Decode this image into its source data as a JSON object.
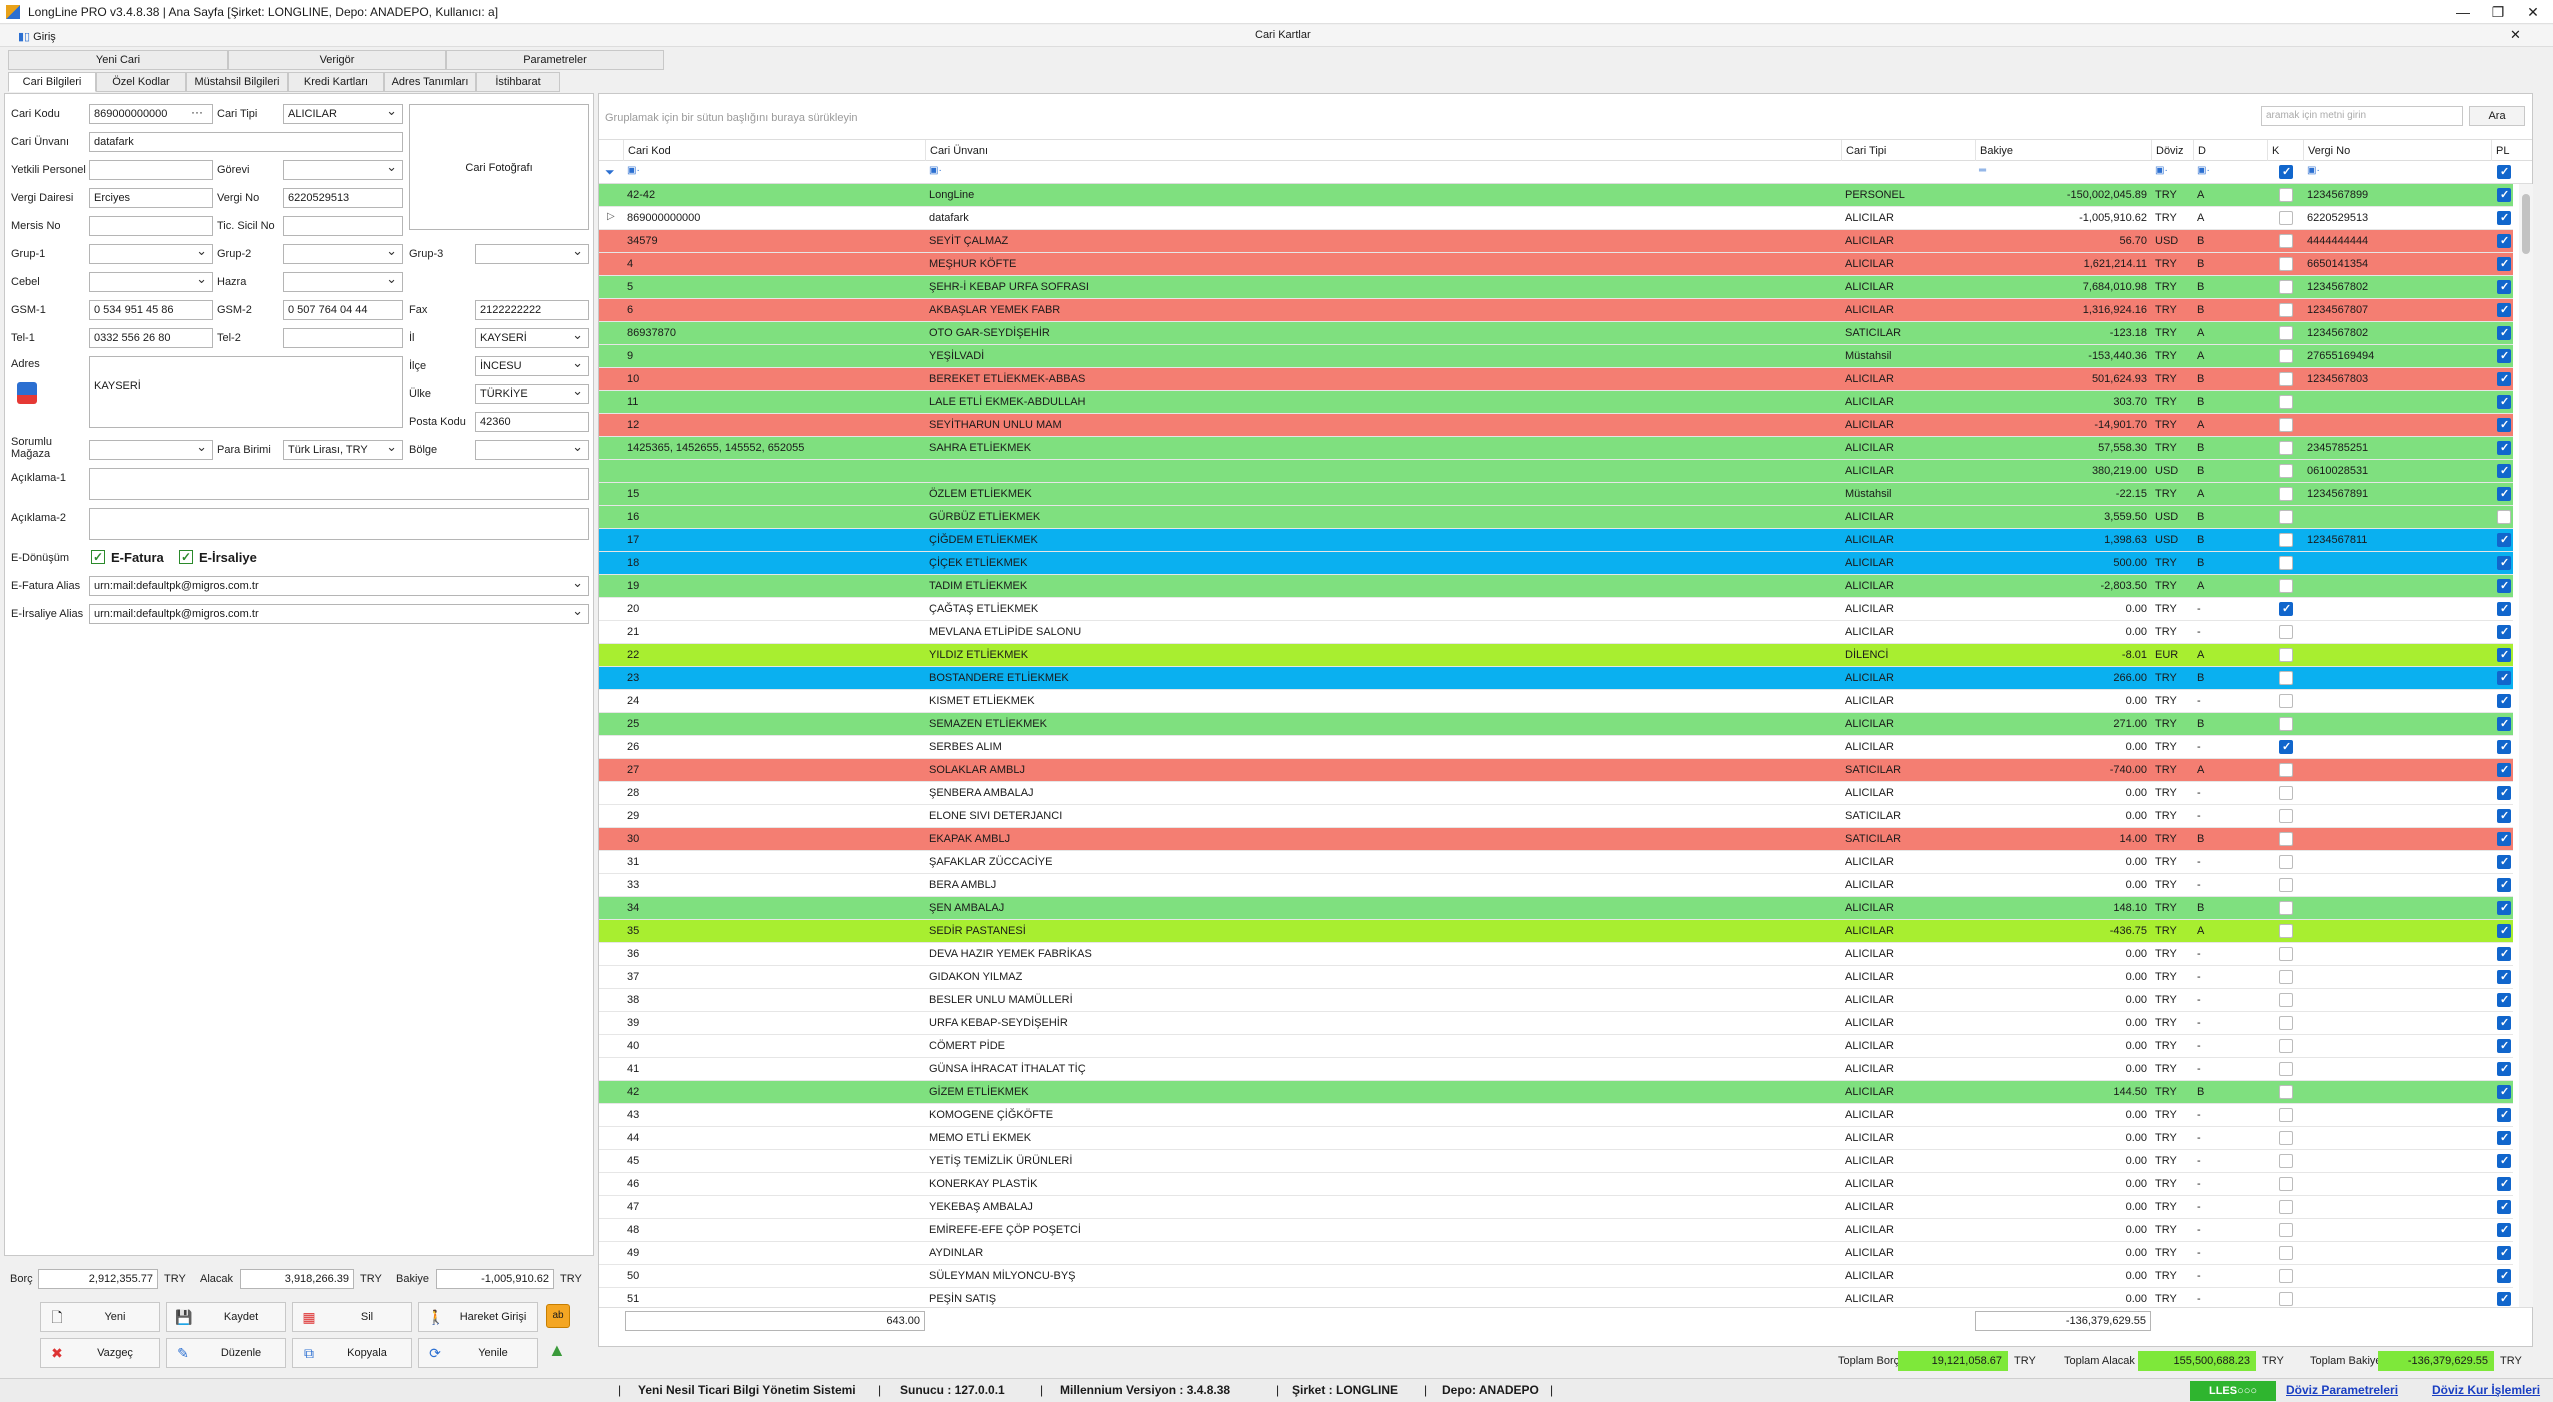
{
  "window": {
    "title": "LongLine PRO v3.4.8.38 | Ana Sayfa [Şirket: LONGLINE, Depo: ANADEPO, Kullanıcı: a]",
    "left_tab": "Giriş",
    "right_tab": "Cari Kartlar"
  },
  "top_tabs": [
    "Yeni Cari",
    "Verigör",
    "Parametreler"
  ],
  "sub_tabs": [
    "Cari Bilgileri",
    "Özel Kodlar",
    "Müstahsil Bilgileri",
    "Kredi Kartları",
    "Adres Tanımları",
    "İstihbarat"
  ],
  "form": {
    "cari_kodu_label": "Cari Kodu",
    "cari_kodu": "869000000000",
    "cari_tipi_label": "Cari Tipi",
    "cari_tipi": "ALICILAR",
    "cari_unvani_label": "Cari Ünvanı",
    "cari_unvani": "datafark",
    "photo_label": "Cari Fotoğrafı",
    "yetkili_label": "Yetkili Personel",
    "yetkili": "",
    "gorevi_label": "Görevi",
    "gorevi": "",
    "vergi_dairesi_label": "Vergi Dairesi",
    "vergi_dairesi": "Erciyes",
    "vergi_no_label": "Vergi No",
    "vergi_no": "6220529513",
    "mersis_label": "Mersis No",
    "mersis": "",
    "sicil_label": "Tic. Sicil No",
    "sicil": "",
    "grup1_label": "Grup-1",
    "grup2_label": "Grup-2",
    "grup3_label": "Grup-3",
    "cebel_label": "Cebel",
    "hazra_label": "Hazra",
    "gsm1_label": "GSM-1",
    "gsm1": "0 534 951 45 86",
    "gsm2_label": "GSM-2",
    "gsm2": "0 507 764 04 44",
    "fax_label": "Fax",
    "fax": "2122222222",
    "tel1_label": "Tel-1",
    "tel1": "0332 556 26 80",
    "tel2_label": "Tel-2",
    "tel2": "",
    "il_label": "İl",
    "il": "KAYSERİ",
    "adres_label": "Adres",
    "adres": "KAYSERİ",
    "ilce_label": "İlçe",
    "ilce": "İNCESU",
    "ulke_label": "Ülke",
    "ulke": "TÜRKİYE",
    "posta_label": "Posta Kodu",
    "posta": "42360",
    "sorumlu_label": "Sorumlu Mağaza",
    "para_label": "Para Birimi",
    "para": "Türk Lirası, TRY",
    "bolge_label": "Bölge",
    "aciklama1_label": "Açıklama-1",
    "aciklama2_label": "Açıklama-2",
    "edonusum_label": "E-Dönüşüm",
    "efatura": "E-Fatura",
    "eirsaliye": "E-İrsaliye",
    "efatura_alias_label": "E-Fatura Alias",
    "efatura_alias": "urn:mail:defaultpk@migros.com.tr",
    "eirsaliye_alias_label": "E-İrsaliye Alias",
    "eirsaliye_alias": "urn:mail:defaultpk@migros.com.tr"
  },
  "totals": {
    "borc_label": "Borç",
    "borc": "2,912,355.77",
    "borc_cur": "TRY",
    "alacak_label": "Alacak",
    "alacak": "3,918,266.39",
    "alacak_cur": "TRY",
    "bakiye_label": "Bakiye",
    "bakiye": "-1,005,910.62",
    "bakiye_cur": "TRY"
  },
  "buttons": {
    "yeni": "Yeni",
    "kaydet": "Kaydet",
    "sil": "Sil",
    "hareket": "Hareket Girişi",
    "vazgec": "Vazgeç",
    "duzenle": "Düzenle",
    "kopyala": "Kopyala",
    "yenile": "Yenile"
  },
  "grid": {
    "group_hint": "Gruplamak için bir sütun başlığını buraya sürükleyin",
    "search_placeholder": "aramak için metni girin",
    "search_button": "Ara",
    "columns": [
      "Cari Kod",
      "Cari Ünvanı",
      "Cari Tipi",
      "Bakiye",
      "Döviz",
      "D",
      "K",
      "Vergi No",
      "PL"
    ],
    "rows": [
      {
        "kod": "42-42",
        "unvan": "LongLine",
        "tip": "PERSONEL",
        "bakiye": "-150,002,045.89",
        "doviz": "TRY",
        "d": "A",
        "k": false,
        "vno": "1234567899",
        "pl": true,
        "bg": "#7fe07f"
      },
      {
        "kod": "869000000000",
        "unvan": "datafark",
        "tip": "ALICILAR",
        "bakiye": "-1,005,910.62",
        "doviz": "TRY",
        "d": "A",
        "k": false,
        "vno": "6220529513",
        "pl": true,
        "bg": "#ffffff",
        "sel": true
      },
      {
        "kod": "34579",
        "unvan": "SEYİT ÇALMAZ",
        "tip": "ALICILAR",
        "bakiye": "56.70",
        "doviz": "USD",
        "d": "B",
        "k": false,
        "vno": "4444444444",
        "pl": true,
        "bg": "#f47e72"
      },
      {
        "kod": "4",
        "unvan": "MEŞHUR KÖFTE",
        "tip": "ALICILAR",
        "bakiye": "1,621,214.11",
        "doviz": "TRY",
        "d": "B",
        "k": false,
        "vno": "6650141354",
        "pl": true,
        "bg": "#f47e72"
      },
      {
        "kod": "5",
        "unvan": "ŞEHR-İ KEBAP URFA SOFRASI",
        "tip": "ALICILAR",
        "bakiye": "7,684,010.98",
        "doviz": "TRY",
        "d": "B",
        "k": false,
        "vno": "1234567802",
        "pl": true,
        "bg": "#7fe07f"
      },
      {
        "kod": "6",
        "unvan": "AKBAŞLAR YEMEK FABR",
        "tip": "ALICILAR",
        "bakiye": "1,316,924.16",
        "doviz": "TRY",
        "d": "B",
        "k": false,
        "vno": "1234567807",
        "pl": true,
        "bg": "#f47e72"
      },
      {
        "kod": "86937870",
        "unvan": "OTO GAR-SEYDİŞEHİR",
        "tip": "SATICILAR",
        "bakiye": "-123.18",
        "doviz": "TRY",
        "d": "A",
        "k": false,
        "vno": "1234567802",
        "pl": true,
        "bg": "#7fe07f"
      },
      {
        "kod": "9",
        "unvan": "YEŞİLVADİ",
        "tip": "Müstahsil",
        "bakiye": "-153,440.36",
        "doviz": "TRY",
        "d": "A",
        "k": false,
        "vno": "27655169494",
        "pl": true,
        "bg": "#7fe07f"
      },
      {
        "kod": "10",
        "unvan": "BEREKET ETLİEKMEK-ABBAS",
        "tip": "ALICILAR",
        "bakiye": "501,624.93",
        "doviz": "TRY",
        "d": "B",
        "k": false,
        "vno": "1234567803",
        "pl": true,
        "bg": "#f47e72"
      },
      {
        "kod": "11",
        "unvan": "LALE ETLİ EKMEK-ABDULLAH",
        "tip": "ALICILAR",
        "bakiye": "303.70",
        "doviz": "TRY",
        "d": "B",
        "k": false,
        "vno": "",
        "pl": true,
        "bg": "#7fe07f"
      },
      {
        "kod": "12",
        "unvan": "SEYİTHARUN UNLU MAM",
        "tip": "ALICILAR",
        "bakiye": "-14,901.70",
        "doviz": "TRY",
        "d": "A",
        "k": false,
        "vno": "",
        "pl": true,
        "bg": "#f47e72"
      },
      {
        "kod": "1425365, 1452655, 145552, 652055",
        "unvan": "SAHRA ETLİEKMEK",
        "tip": "ALICILAR",
        "bakiye": "57,558.30",
        "doviz": "TRY",
        "d": "B",
        "k": false,
        "vno": "2345785251",
        "pl": true,
        "bg": "#7fe07f"
      },
      {
        "kod": "",
        "unvan": "",
        "tip": "ALICILAR",
        "bakiye": "380,219.00",
        "doviz": "USD",
        "d": "B",
        "k": false,
        "vno": "0610028531",
        "pl": true,
        "bg": "#7fe07f"
      },
      {
        "kod": "15",
        "unvan": "ÖZLEM ETLİEKMEK",
        "tip": "Müstahsil",
        "bakiye": "-22.15",
        "doviz": "TRY",
        "d": "A",
        "k": false,
        "vno": "1234567891",
        "pl": true,
        "bg": "#7fe07f"
      },
      {
        "kod": "16",
        "unvan": "GÜRBÜZ ETLİEKMEK",
        "tip": "ALICILAR",
        "bakiye": "3,559.50",
        "doviz": "USD",
        "d": "B",
        "k": false,
        "vno": "",
        "pl": false,
        "bg": "#7fe07f"
      },
      {
        "kod": "17",
        "unvan": "ÇİĞDEM ETLİEKMEK",
        "tip": "ALICILAR",
        "bakiye": "1,398.63",
        "doviz": "USD",
        "d": "B",
        "k": false,
        "vno": "1234567811",
        "pl": true,
        "bg": "#0ab0f0"
      },
      {
        "kod": "18",
        "unvan": "ÇİÇEK ETLİEKMEK",
        "tip": "ALICILAR",
        "bakiye": "500.00",
        "doviz": "TRY",
        "d": "B",
        "k": false,
        "vno": "",
        "pl": true,
        "bg": "#0ab0f0"
      },
      {
        "kod": "19",
        "unvan": "TADIM ETLİEKMEK",
        "tip": "ALICILAR",
        "bakiye": "-2,803.50",
        "doviz": "TRY",
        "d": "A",
        "k": false,
        "vno": "",
        "pl": true,
        "bg": "#7fe07f"
      },
      {
        "kod": "20",
        "unvan": "ÇAĞTAŞ ETLİEKMEK",
        "tip": "ALICILAR",
        "bakiye": "0.00",
        "doviz": "TRY",
        "d": "-",
        "k": true,
        "vno": "",
        "pl": true,
        "bg": "#ffffff"
      },
      {
        "kod": "21",
        "unvan": "MEVLANA ETLİPİDE SALONU",
        "tip": "ALICILAR",
        "bakiye": "0.00",
        "doviz": "TRY",
        "d": "-",
        "k": false,
        "vno": "",
        "pl": true,
        "bg": "#ffffff"
      },
      {
        "kod": "22",
        "unvan": "YILDIZ ETLİEKMEK",
        "tip": "DİLENCİ",
        "bakiye": "-8.01",
        "doviz": "EUR",
        "d": "A",
        "k": false,
        "vno": "",
        "pl": true,
        "bg": "#a8ee30"
      },
      {
        "kod": "23",
        "unvan": "BOSTANDERE ETLİEKMEK",
        "tip": "ALICILAR",
        "bakiye": "266.00",
        "doviz": "TRY",
        "d": "B",
        "k": false,
        "vno": "",
        "pl": true,
        "bg": "#0ab0f0"
      },
      {
        "kod": "24",
        "unvan": "KISMET ETLİEKMEK",
        "tip": "ALICILAR",
        "bakiye": "0.00",
        "doviz": "TRY",
        "d": "-",
        "k": false,
        "vno": "",
        "pl": true,
        "bg": "#ffffff"
      },
      {
        "kod": "25",
        "unvan": "SEMAZEN ETLİEKMEK",
        "tip": "ALICILAR",
        "bakiye": "271.00",
        "doviz": "TRY",
        "d": "B",
        "k": false,
        "vno": "",
        "pl": true,
        "bg": "#7fe07f"
      },
      {
        "kod": "26",
        "unvan": "SERBES ALIM",
        "tip": "ALICILAR",
        "bakiye": "0.00",
        "doviz": "TRY",
        "d": "-",
        "k": true,
        "vno": "",
        "pl": true,
        "bg": "#ffffff"
      },
      {
        "kod": "27",
        "unvan": "SOLAKLAR AMBLJ",
        "tip": "SATICILAR",
        "bakiye": "-740.00",
        "doviz": "TRY",
        "d": "A",
        "k": false,
        "vno": "",
        "pl": true,
        "bg": "#f47e72"
      },
      {
        "kod": "28",
        "unvan": "ŞENBERA AMBALAJ",
        "tip": "ALICILAR",
        "bakiye": "0.00",
        "doviz": "TRY",
        "d": "-",
        "k": false,
        "vno": "",
        "pl": true,
        "bg": "#ffffff"
      },
      {
        "kod": "29",
        "unvan": "ELONE SIVI DETERJANCI",
        "tip": "SATICILAR",
        "bakiye": "0.00",
        "doviz": "TRY",
        "d": "-",
        "k": false,
        "vno": "",
        "pl": true,
        "bg": "#ffffff"
      },
      {
        "kod": "30",
        "unvan": "EKAPAK AMBLJ",
        "tip": "SATICILAR",
        "bakiye": "14.00",
        "doviz": "TRY",
        "d": "B",
        "k": false,
        "vno": "",
        "pl": true,
        "bg": "#f47e72"
      },
      {
        "kod": "31",
        "unvan": "ŞAFAKLAR ZÜCCACİYE",
        "tip": "ALICILAR",
        "bakiye": "0.00",
        "doviz": "TRY",
        "d": "-",
        "k": false,
        "vno": "",
        "pl": true,
        "bg": "#ffffff"
      },
      {
        "kod": "33",
        "unvan": "BERA AMBLJ",
        "tip": "ALICILAR",
        "bakiye": "0.00",
        "doviz": "TRY",
        "d": "-",
        "k": false,
        "vno": "",
        "pl": true,
        "bg": "#ffffff"
      },
      {
        "kod": "34",
        "unvan": "ŞEN AMBALAJ",
        "tip": "ALICILAR",
        "bakiye": "148.10",
        "doviz": "TRY",
        "d": "B",
        "k": false,
        "vno": "",
        "pl": true,
        "bg": "#7fe07f"
      },
      {
        "kod": "35",
        "unvan": "SEDİR PASTANESİ",
        "tip": "ALICILAR",
        "bakiye": "-436.75",
        "doviz": "TRY",
        "d": "A",
        "k": false,
        "vno": "",
        "pl": true,
        "bg": "#a8ee30"
      },
      {
        "kod": "36",
        "unvan": "DEVA HAZIR YEMEK FABRİKAS",
        "tip": "ALICILAR",
        "bakiye": "0.00",
        "doviz": "TRY",
        "d": "-",
        "k": false,
        "vno": "",
        "pl": true,
        "bg": "#ffffff"
      },
      {
        "kod": "37",
        "unvan": "GIDAKON YILMAZ",
        "tip": "ALICILAR",
        "bakiye": "0.00",
        "doviz": "TRY",
        "d": "-",
        "k": false,
        "vno": "",
        "pl": true,
        "bg": "#ffffff"
      },
      {
        "kod": "38",
        "unvan": "BESLER UNLU MAMÜLLERİ",
        "tip": "ALICILAR",
        "bakiye": "0.00",
        "doviz": "TRY",
        "d": "-",
        "k": false,
        "vno": "",
        "pl": true,
        "bg": "#ffffff"
      },
      {
        "kod": "39",
        "unvan": "URFA KEBAP-SEYDİŞEHİR",
        "tip": "ALICILAR",
        "bakiye": "0.00",
        "doviz": "TRY",
        "d": "-",
        "k": false,
        "vno": "",
        "pl": true,
        "bg": "#ffffff"
      },
      {
        "kod": "40",
        "unvan": "CÖMERT PİDE",
        "tip": "ALICILAR",
        "bakiye": "0.00",
        "doviz": "TRY",
        "d": "-",
        "k": false,
        "vno": "",
        "pl": true,
        "bg": "#ffffff"
      },
      {
        "kod": "41",
        "unvan": "GÜNSA İHRACAT İTHALAT TİÇ",
        "tip": "ALICILAR",
        "bakiye": "0.00",
        "doviz": "TRY",
        "d": "-",
        "k": false,
        "vno": "",
        "pl": true,
        "bg": "#ffffff"
      },
      {
        "kod": "42",
        "unvan": "GİZEM ETLİEKMEK",
        "tip": "ALICILAR",
        "bakiye": "144.50",
        "doviz": "TRY",
        "d": "B",
        "k": false,
        "vno": "",
        "pl": true,
        "bg": "#7fe07f"
      },
      {
        "kod": "43",
        "unvan": "KOMOGENE ÇİĞKÖFTE",
        "tip": "ALICILAR",
        "bakiye": "0.00",
        "doviz": "TRY",
        "d": "-",
        "k": false,
        "vno": "",
        "pl": true,
        "bg": "#ffffff"
      },
      {
        "kod": "44",
        "unvan": "MEMO ETLİ EKMEK",
        "tip": "ALICILAR",
        "bakiye": "0.00",
        "doviz": "TRY",
        "d": "-",
        "k": false,
        "vno": "",
        "pl": true,
        "bg": "#ffffff"
      },
      {
        "kod": "45",
        "unvan": "YETİŞ TEMİZLİK ÜRÜNLERİ",
        "tip": "ALICILAR",
        "bakiye": "0.00",
        "doviz": "TRY",
        "d": "-",
        "k": false,
        "vno": "",
        "pl": true,
        "bg": "#ffffff"
      },
      {
        "kod": "46",
        "unvan": "KONERKAY PLASTİK",
        "tip": "ALICILAR",
        "bakiye": "0.00",
        "doviz": "TRY",
        "d": "-",
        "k": false,
        "vno": "",
        "pl": true,
        "bg": "#ffffff"
      },
      {
        "kod": "47",
        "unvan": "YEKEBAŞ AMBALAJ",
        "tip": "ALICILAR",
        "bakiye": "0.00",
        "doviz": "TRY",
        "d": "-",
        "k": false,
        "vno": "",
        "pl": true,
        "bg": "#ffffff"
      },
      {
        "kod": "48",
        "unvan": "EMİREFE-EFE ÇÖP POŞETCİ",
        "tip": "ALICILAR",
        "bakiye": "0.00",
        "doviz": "TRY",
        "d": "-",
        "k": false,
        "vno": "",
        "pl": true,
        "bg": "#ffffff"
      },
      {
        "kod": "49",
        "unvan": "AYDINLAR",
        "tip": "ALICILAR",
        "bakiye": "0.00",
        "doviz": "TRY",
        "d": "-",
        "k": false,
        "vno": "",
        "pl": true,
        "bg": "#ffffff"
      },
      {
        "kod": "50",
        "unvan": "SÜLEYMAN MİLYONCU-BYŞ",
        "tip": "ALICILAR",
        "bakiye": "0.00",
        "doviz": "TRY",
        "d": "-",
        "k": false,
        "vno": "",
        "pl": true,
        "bg": "#ffffff"
      },
      {
        "kod": "51",
        "unvan": "PEŞİN SATIŞ",
        "tip": "ALICILAR",
        "bakiye": "0.00",
        "doviz": "TRY",
        "d": "-",
        "k": false,
        "vno": "",
        "pl": true,
        "bg": "#ffffff"
      }
    ],
    "footer_count": "643.00",
    "footer_bakiye": "-136,379,629.55"
  },
  "grand_totals": {
    "borc_label": "Toplam Borç",
    "borc": "19,121,058.67",
    "borc_cur": "TRY",
    "alacak_label": "Toplam Alacak",
    "alacak": "155,500,688.23",
    "alacak_cur": "TRY",
    "bakiye_label": "Toplam Bakiye",
    "bakiye": "-136,379,629.55",
    "bakiye_cur": "TRY",
    "highlight": "#7ee83a"
  },
  "status": {
    "system": "Yeni Nesil Ticari Bilgi Yönetim Sistemi",
    "sunucu": "Sunucu : 127.0.0.1",
    "version": "Millennium Versiyon : 3.4.8.38",
    "sirket": "Şirket : LONGLINE",
    "depo": "Depo: ANADEPO",
    "badge": "LLES○○○",
    "doviz_param": "Döviz Parametreleri",
    "doviz_kur": "Döviz Kur İşlemleri"
  }
}
